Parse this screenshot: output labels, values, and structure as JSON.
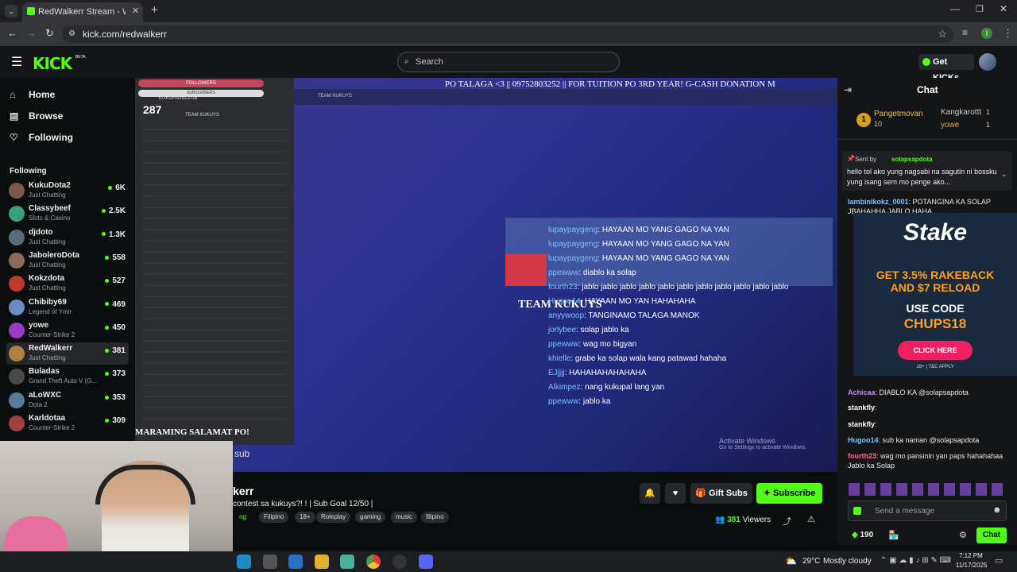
{
  "browser": {
    "tab_title": "RedWalkerr Stream - Watch Liv",
    "url": "kick.com/redwalkerr",
    "profile_initial": "I"
  },
  "header": {
    "logo": "KICK",
    "logo_badge": "BETA",
    "search_placeholder": "Search",
    "get_kicks": "Get KICKs"
  },
  "sidebar": {
    "nav": [
      {
        "label": "Home",
        "icon": "home-icon"
      },
      {
        "label": "Browse",
        "icon": "browse-icon"
      },
      {
        "label": "Following",
        "icon": "heart-icon"
      }
    ],
    "following_title": "Following",
    "channels": [
      {
        "name": "KukuDota2",
        "game": "Just Chatting",
        "viewers": "6K",
        "color": "#7a5a4a"
      },
      {
        "name": "Classybeef",
        "game": "Slots & Casino",
        "viewers": "2.5K",
        "color": "#3aa07a"
      },
      {
        "name": "djdoto",
        "game": "Just Chatting",
        "viewers": "1.3K",
        "color": "#5a6a7a"
      },
      {
        "name": "JaboleroDota",
        "game": "Just Chatting",
        "viewers": "558",
        "color": "#8a6a5a"
      },
      {
        "name": "Kokzdota",
        "game": "Just Chatting",
        "viewers": "527",
        "color": "#c0392b"
      },
      {
        "name": "Chibiby69",
        "game": "Legend of Ymir",
        "viewers": "469",
        "color": "#6a8ac0"
      },
      {
        "name": "yowe",
        "game": "Counter-Strike 2",
        "viewers": "450",
        "color": "#9a3ac0"
      },
      {
        "name": "RedWalkerr",
        "game": "Just Chatting",
        "viewers": "381",
        "color": "#b08040"
      },
      {
        "name": "Buladas",
        "game": "Grand Theft Auto V (G...",
        "viewers": "373",
        "color": "#4a4a4a"
      },
      {
        "name": "aLoWXC",
        "game": "Dota 2",
        "viewers": "353",
        "color": "#5a7a9a"
      },
      {
        "name": "Karldotaa",
        "game": "Counter-Strike 2",
        "viewers": "309",
        "color": "#a04040"
      }
    ]
  },
  "video": {
    "ticker": "PO TALAGA <3  ||  09752803252  ||  FOR TUITION PO 3RD YEAR! G-CASH DONATION M",
    "discord_followers_label": "FOLLOWERS",
    "discord_subscribers_label": "SUBSCRIBERS",
    "discord_count": "287",
    "discord_club": "KUKUFANSCLUB",
    "team_label": "TEAM KUKUYS",
    "team_overlay": "TEAM KUKUYS",
    "bottom_caption": "MARAMING SALAMAT PO!",
    "sub_text": "sub",
    "activate_title": "Activate Windows",
    "activate_sub": "Go to Settings to activate Windows.",
    "chat_lines": [
      {
        "user": "lupaypaygeng",
        "text": ": HAYAAN MO YANG GAGO NA YAN"
      },
      {
        "user": "lupaypaygeng",
        "text": ": HAYAAN MO YANG GAGO NA YAN"
      },
      {
        "user": "lupaypaygeng",
        "text": ": HAYAAN MO YANG GAGO NA YAN"
      },
      {
        "user": "ppewww",
        "text": ": diablo ka solap"
      },
      {
        "user": "fourth23",
        "text": ": jablo jablo jablo jablo jablo jablo jablo jablo jablo jablo jablo"
      },
      {
        "user": "Hugoo14",
        "text": ": HAYAAN MO YAN HAHAHAHA"
      },
      {
        "user": "anyywoop",
        "text": ": TANGINAMO TALAGA MANOK"
      },
      {
        "user": "jorlybee",
        "text": ": solap jablo ka"
      },
      {
        "user": "ppewww",
        "text": ": wag mo bigyan"
      },
      {
        "user": "khielle",
        "text": ": grabe ka solap wala kang patawad hahaha"
      },
      {
        "user": "EJjjjj",
        "text": ": HAHAHAHAHAHAHA"
      },
      {
        "user": "Alkimpez",
        "text": ": nang kukupal lang yan"
      },
      {
        "user": "ppewww",
        "text": ": jablo ka"
      }
    ]
  },
  "stream_info": {
    "name_fragment": "kerr",
    "title_fragment": "contest sa kukuys?! ! | Sub Goal 12/50 |",
    "tags": [
      "ng",
      "Filipino",
      "18+",
      "Roleplay",
      "gaming",
      "music",
      "filipino"
    ],
    "gift_subs": "Gift Subs",
    "subscribe": "Subscribe",
    "viewers": "381",
    "viewers_label": "Viewers"
  },
  "chat": {
    "title": "Chat",
    "top_gifters": [
      {
        "rank": "1",
        "name": "Pangetmovan",
        "count": "10"
      },
      {
        "name": "Kangkarottt",
        "count": "1"
      },
      {
        "name": "yowe",
        "count": "1"
      }
    ],
    "pinned_by_label": "Sent by",
    "pinned_by": "solapsapdota",
    "pinned_text": "hello tol ako yung nagsabi na sagutin ni bossku yung isang sem mo penge ako...",
    "messages": [
      {
        "user": "lambinikokz_0001",
        "text": ": POTANGINA KA SOLAP JBAHAHHA JABLO HAHA",
        "color": "#7ec2ff"
      },
      {
        "user": "Achicaa",
        "text": ": DIABLO KA @solapsapdota",
        "color": "#c38cff"
      },
      {
        "user": "stankfly",
        "text": ":",
        "color": "#ffffff"
      },
      {
        "user": "stankfly",
        "text": ":",
        "color": "#ffffff"
      },
      {
        "user": "Hugoo14",
        "text": ": sub ka naman @solapsapdota",
        "color": "#7ec2ff"
      },
      {
        "user": "fourth23",
        "text": ": wag mo pansinin yan paps hahahahaa Jablo ka Solap",
        "color": "#ff6b8a"
      }
    ],
    "ad": {
      "brand": "Stake",
      "line1": "GET 3.5% RAKEBACK",
      "line2": "AND $7 RELOAD",
      "line3": "USE CODE",
      "code": "CHUPS18",
      "cta": "CLICK HERE",
      "fine": "18+ | T&C APPLY"
    },
    "input_placeholder": "Send a message",
    "kicks": "190",
    "chat_button": "Chat"
  },
  "taskbar": {
    "weather_temp": "29°C",
    "weather_text": "Mostly cloudy",
    "time": "7:12 PM",
    "date": "11/17/2025"
  }
}
